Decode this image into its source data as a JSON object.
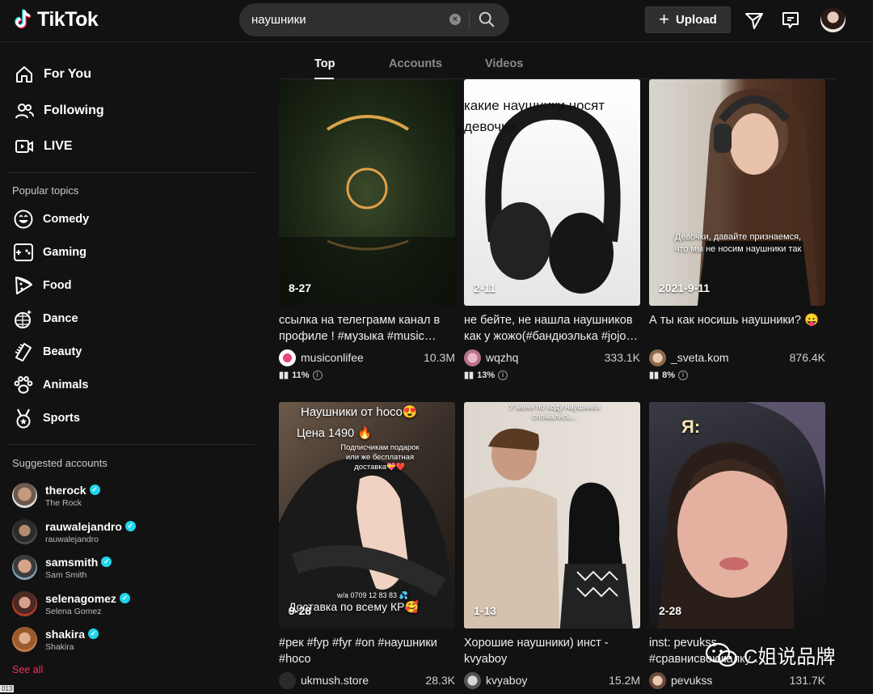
{
  "header": {
    "logo_text": "TikTok",
    "search_value": "наушники",
    "upload_label": "Upload"
  },
  "sidebar": {
    "nav": [
      {
        "label": "For You",
        "icon": "home-icon"
      },
      {
        "label": "Following",
        "icon": "users-icon"
      },
      {
        "label": "LIVE",
        "icon": "live-icon"
      }
    ],
    "popular_title": "Popular topics",
    "topics": [
      {
        "label": "Comedy",
        "icon": "smile-icon"
      },
      {
        "label": "Gaming",
        "icon": "gamepad-icon"
      },
      {
        "label": "Food",
        "icon": "pizza-icon"
      },
      {
        "label": "Dance",
        "icon": "disco-ball-icon"
      },
      {
        "label": "Beauty",
        "icon": "comb-icon"
      },
      {
        "label": "Animals",
        "icon": "paw-icon"
      },
      {
        "label": "Sports",
        "icon": "medal-icon"
      }
    ],
    "suggested_title": "Suggested accounts",
    "accounts": [
      {
        "username": "therock",
        "name": "The Rock"
      },
      {
        "username": "rauwalejandro",
        "name": "rauwalejandro"
      },
      {
        "username": "samsmith",
        "name": "Sam Smith"
      },
      {
        "username": "selenagomez",
        "name": "Selena Gomez"
      },
      {
        "username": "shakira",
        "name": "Shakira"
      }
    ],
    "see_all": "See all",
    "corner_tag": "013"
  },
  "tabs": [
    "Top",
    "Accounts",
    "Videos"
  ],
  "cards": [
    {
      "date": "8-27",
      "desc": "ссылка на телеграмм канал в профиле ! #музыка #music…",
      "user": "musiconlifee",
      "views": "10.3M",
      "stat": "11%"
    },
    {
      "date": "2-11",
      "overlay": "какие наушники носят девочки:",
      "desc": "не бейте, не нашла наушников как у жожо(#бандюэлька #jojo…",
      "user": "wqzhq",
      "views": "333.1K",
      "stat": "13%"
    },
    {
      "date": "2021-9-11",
      "overlay": "Девочки, давайте признаемся, что мы не носим наушники так",
      "desc": "А ты как носишь наушники? 😛",
      "user": "_sveta.kom",
      "views": "876.4K",
      "stat": "8%"
    },
    {
      "date": "9-28",
      "overlay": "Наушники от hoco😍",
      "overlay2": "Цена 1490 🔥",
      "overlay3": "Подписчикам подарок или же бесплатная доставка💝❤️",
      "overlay4": "w/a 0709 12 83 83 💦",
      "overlay5": "Доставка по всему КР🥰",
      "desc": "#рек #fyp #fyr #on #наушники #hoco",
      "user": "ukmush.store",
      "views": "28.3K"
    },
    {
      "date": "1-13",
      "overlay": "У меня по ходу наушники сломались...",
      "desc": "Хорошие наушники) инст - kvyaboy",
      "user": "kvyaboy",
      "views": "15.2M"
    },
    {
      "date": "2-28",
      "overlay": "Я:",
      "desc": "inst: pevukss #сравнисвоюкалку…",
      "user": "pevukss",
      "views": "131.7K"
    }
  ],
  "watermark": "C姐说品牌"
}
